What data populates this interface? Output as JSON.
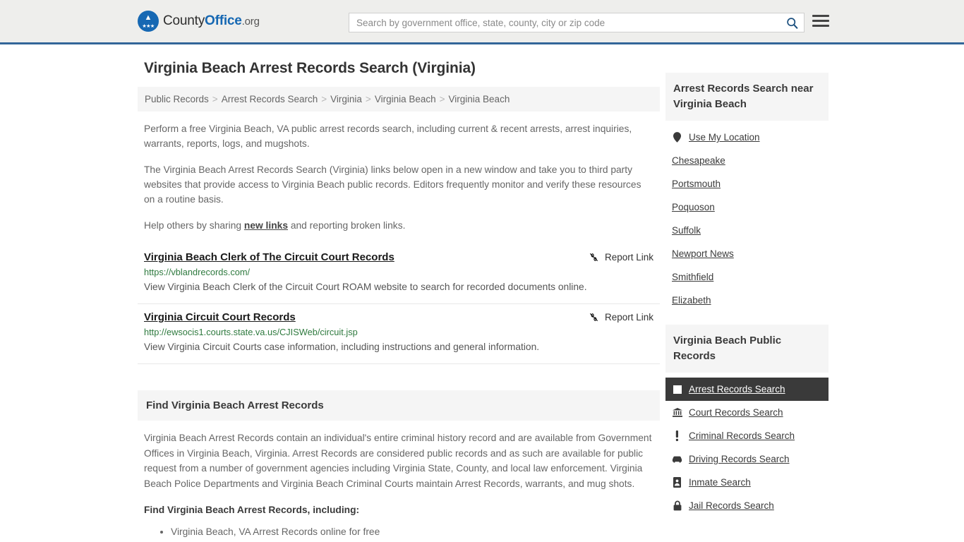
{
  "header": {
    "logo": {
      "part1": "County",
      "part2": "Office",
      "part3": ".org",
      "icon": "eagle-seal-icon"
    },
    "search": {
      "placeholder": "Search by government office, state, county, city or zip code",
      "value": "",
      "icon": "search-icon"
    },
    "menu_icon": "hamburger-menu-icon"
  },
  "page_title": "Virginia Beach Arrest Records Search (Virginia)",
  "breadcrumb": {
    "separator": ">",
    "items": [
      {
        "label": "Public Records"
      },
      {
        "label": "Arrest Records Search"
      },
      {
        "label": "Virginia"
      },
      {
        "label": "Virginia Beach"
      },
      {
        "label": "Virginia Beach"
      }
    ]
  },
  "intro": {
    "p1": "Perform a free Virginia Beach, VA public arrest records search, including current & recent arrests, arrest inquiries, warrants, reports, logs, and mugshots.",
    "p2": "The Virginia Beach Arrest Records Search (Virginia) links below open in a new window and take you to third party websites that provide access to Virginia Beach public records. Editors frequently monitor and verify these resources on a routine basis.",
    "p3_before": "Help others by sharing ",
    "p3_link": "new links",
    "p3_after": " and reporting broken links."
  },
  "listings": [
    {
      "title": "Virginia Beach Clerk of The Circuit Court Records",
      "url": "https://vblandrecords.com/",
      "description": "View Virginia Beach Clerk of the Circuit Court ROAM website to search for recorded documents online.",
      "report_label": "Report Link",
      "report_icon": "broken-link-icon"
    },
    {
      "title": "Virginia Circuit Court Records",
      "url": "http://ewsocis1.courts.state.va.us/CJISWeb/circuit.jsp",
      "description": "View Virginia Circuit Courts case information, including instructions and general information.",
      "report_label": "Report Link",
      "report_icon": "broken-link-icon"
    }
  ],
  "section": {
    "heading": "Find Virginia Beach Arrest Records",
    "body": "Virginia Beach Arrest Records contain an individual's entire criminal history record and are available from Government Offices in Virginia Beach, Virginia. Arrest Records are considered public records and as such are available for public request from a number of government agencies including Virginia State, County, and local law enforcement. Virginia Beach Police Departments and Virginia Beach Criminal Courts maintain Arrest Records, warrants, and mug shots.",
    "subheading": "Find Virginia Beach Arrest Records, including:",
    "bullets": [
      {
        "label": "Virginia Beach, VA Arrest Records online for free"
      }
    ]
  },
  "sidebar": {
    "near_card": {
      "heading": "Arrest Records Search near Virginia Beach",
      "items": [
        {
          "label": "Use My Location",
          "icon": "map-pin-icon"
        },
        {
          "label": "Chesapeake",
          "icon": ""
        },
        {
          "label": "Portsmouth",
          "icon": ""
        },
        {
          "label": "Poquoson",
          "icon": ""
        },
        {
          "label": "Suffolk",
          "icon": ""
        },
        {
          "label": "Newport News",
          "icon": ""
        },
        {
          "label": "Smithfield",
          "icon": ""
        },
        {
          "label": "Elizabeth",
          "icon": ""
        }
      ]
    },
    "records_card": {
      "heading": "Virginia Beach Public Records",
      "items": [
        {
          "label": "Arrest Records Search",
          "icon": "square-icon",
          "active": true
        },
        {
          "label": "Court Records Search",
          "icon": "courthouse-icon",
          "active": false
        },
        {
          "label": "Criminal Records Search",
          "icon": "exclamation-icon",
          "active": false
        },
        {
          "label": "Driving Records Search",
          "icon": "car-icon",
          "active": false
        },
        {
          "label": "Inmate Search",
          "icon": "id-badge-icon",
          "active": false
        },
        {
          "label": "Jail Records Search",
          "icon": "lock-icon",
          "active": false
        }
      ]
    }
  },
  "colors": {
    "brand_blue": "#1668b3",
    "header_border": "#336699",
    "url_green": "#2f7a3f",
    "active_bg": "#3a3a3a",
    "panel_gray": "#f5f5f5"
  }
}
